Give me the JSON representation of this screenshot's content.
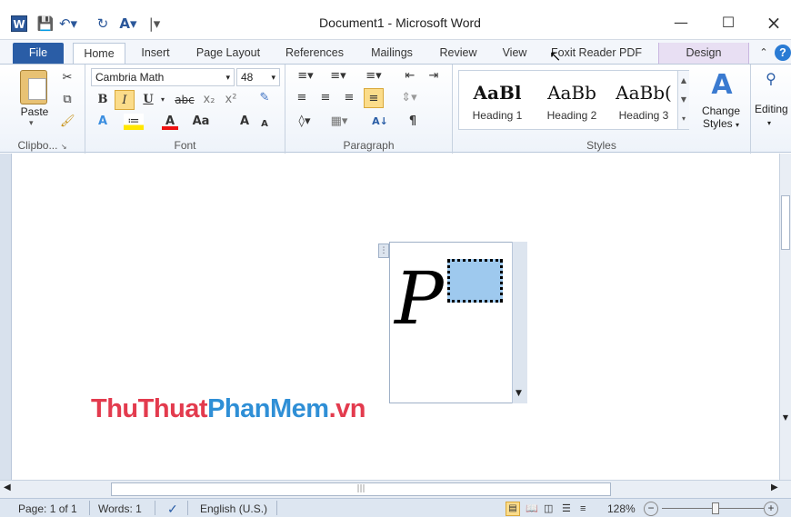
{
  "window": {
    "title": "Document1 - Microsoft Word",
    "app_icon": "word-icon",
    "controls": [
      "minimize-icon",
      "maximize-icon",
      "close-icon"
    ]
  },
  "quick_access": {
    "icons": [
      "save-icon",
      "undo-icon",
      "redo-icon",
      "format-icon",
      "customize-icon"
    ]
  },
  "tabs": {
    "file": "File",
    "home": "Home",
    "insert": "Insert",
    "page_layout": "Page Layout",
    "references": "References",
    "mailings": "Mailings",
    "review": "Review",
    "view": "View",
    "foxit": "Foxit Reader PDF",
    "design": "Design"
  },
  "ribbon": {
    "clipboard": {
      "label": "Clipbo...",
      "paste": "Paste"
    },
    "font": {
      "label": "Font",
      "font_name": "Cambria Math",
      "font_size": "48",
      "bold": "B",
      "italic": "I",
      "underline": "U",
      "strike": "abc",
      "subscript": "x₂",
      "superscript": "x²",
      "grow": "A",
      "shrink": "A",
      "case": "Aa"
    },
    "paragraph": {
      "label": "Paragraph",
      "sort": "A↓",
      "pilcrow": "¶"
    },
    "styles": {
      "label": "Styles",
      "items": [
        {
          "preview": "AaBl",
          "name": "Heading 1"
        },
        {
          "preview": "AaBb",
          "name": "Heading 2"
        },
        {
          "preview": "AaBb(",
          "name": "Heading 3"
        }
      ],
      "change_styles": "Change Styles"
    },
    "editing": {
      "label": "Editing"
    }
  },
  "equation": {
    "base": "P",
    "accent": "#9ec9ee"
  },
  "watermark": {
    "part1": "ThuThuat",
    "part2": "PhanMem",
    "part3": ".vn"
  },
  "status": {
    "page": "Page: 1 of 1",
    "words": "Words: 1",
    "language": "English (U.S.)",
    "zoom": "128%"
  }
}
